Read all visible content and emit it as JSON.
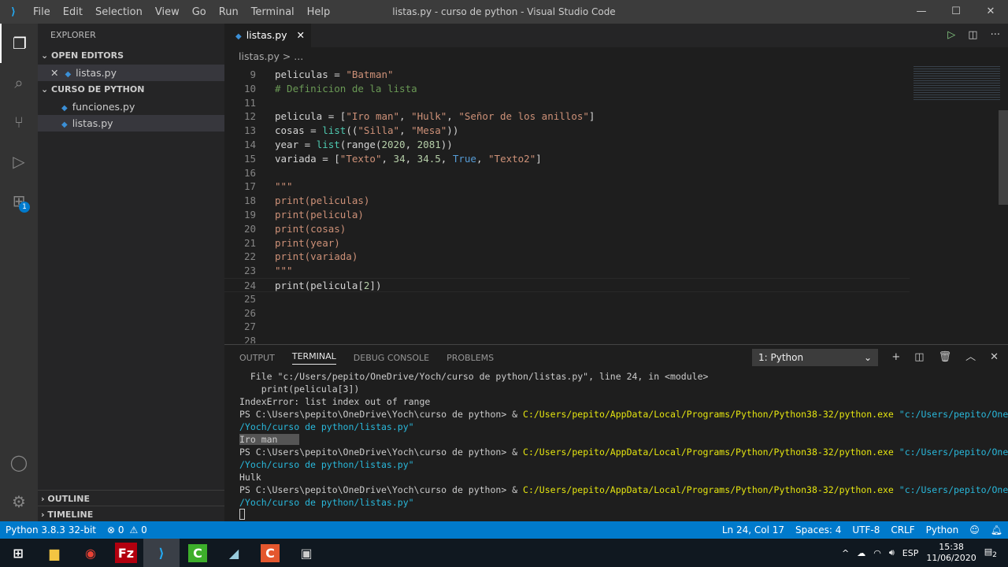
{
  "window": {
    "title": "listas.py - curso de python - Visual Studio Code",
    "menu": [
      "File",
      "Edit",
      "Selection",
      "View",
      "Go",
      "Run",
      "Terminal",
      "Help"
    ]
  },
  "sidebar": {
    "title": "EXPLORER",
    "open_editors": "OPEN EDITORS",
    "open_files": [
      "listas.py"
    ],
    "folder": "CURSO DE PYTHON",
    "files": [
      "funciones.py",
      "listas.py"
    ],
    "outline": "OUTLINE",
    "timeline": "TIMELINE",
    "ext_badge": "1"
  },
  "editor": {
    "tab": "listas.py",
    "breadcrumb": "listas.py > ...",
    "lines": [
      {
        "n": "9",
        "html": "peliculas = <s1>\"Batman\"</s1>"
      },
      {
        "n": "10",
        "html": "<c># Definicion de la lista</c>"
      },
      {
        "n": "11",
        "html": ""
      },
      {
        "n": "12",
        "html": "pelicula = [<s1>\"Iro man\"</s1>, <s1>\"Hulk\"</s1>, <s1>\"Señor de los anillos\"</s1>]"
      },
      {
        "n": "13",
        "html": "cosas = <f>list</f>((<s1>\"Silla\"</s1>, <s1>\"Mesa\"</s1>))"
      },
      {
        "n": "14",
        "html": "year = <f>list</f>(range(<m>2020</m>, <m>2081</m>))"
      },
      {
        "n": "15",
        "html": "variada = [<s1>\"Texto\"</s1>, <m>34</m>, <m>34.5</m>, <k>True</k>, <s1>\"Texto2\"</s1>]"
      },
      {
        "n": "16",
        "html": ""
      },
      {
        "n": "17",
        "html": "<s1>\"\"\"</s1>"
      },
      {
        "n": "18",
        "html": "<s1>print(peliculas)</s1>"
      },
      {
        "n": "19",
        "html": "<s1>print(pelicula)</s1>"
      },
      {
        "n": "20",
        "html": "<s1>print(cosas)</s1>"
      },
      {
        "n": "21",
        "html": "<s1>print(year)</s1>"
      },
      {
        "n": "22",
        "html": "<s1>print(variada)</s1>"
      },
      {
        "n": "23",
        "html": "<s1>\"\"\"</s1>"
      },
      {
        "n": "24",
        "html": "print(pelicula[<m>2</m>])"
      },
      {
        "n": "25",
        "html": ""
      },
      {
        "n": "26",
        "html": ""
      },
      {
        "n": "27",
        "html": ""
      },
      {
        "n": "28",
        "html": ""
      }
    ]
  },
  "panel": {
    "tabs": [
      "OUTPUT",
      "TERMINAL",
      "DEBUG CONSOLE",
      "PROBLEMS"
    ],
    "terminal_select": "1: Python",
    "terminal": [
      [
        "",
        "  File \"c:/Users/pepito/OneDrive/Yoch/curso de python/listas.py\", line 24, in <module>"
      ],
      [
        "",
        "    print(pelicula[3])"
      ],
      [
        "",
        "IndexError: list index out of range"
      ],
      [
        "cmd",
        "PS C:\\Users\\pepito\\OneDrive\\Yoch\\curso de python> & ",
        "C:/Users/pepito/AppData/Local/Programs/Python/Python38-32/python.exe",
        " \"c:/Users/pepito/OneDrive"
      ],
      [
        "b",
        "/Yoch/curso de python/listas.py\""
      ],
      [
        "sel",
        "Iro man"
      ],
      [
        "cmd",
        "PS C:\\Users\\pepito\\OneDrive\\Yoch\\curso de python> & ",
        "C:/Users/pepito/AppData/Local/Programs/Python/Python38-32/python.exe",
        " \"c:/Users/pepito/OneDrive"
      ],
      [
        "b",
        "/Yoch/curso de python/listas.py\""
      ],
      [
        "",
        "Hulk"
      ],
      [
        "cmd",
        "PS C:\\Users\\pepito\\OneDrive\\Yoch\\curso de python> & ",
        "C:/Users/pepito/AppData/Local/Programs/Python/Python38-32/python.exe",
        " \"c:/Users/pepito/OneDrive"
      ],
      [
        "b",
        "/Yoch/curso de python/listas.py\""
      ]
    ]
  },
  "status": {
    "python": "Python 3.8.3 32-bit",
    "errors": "⊗ 0",
    "warnings": "⚠ 0",
    "position": "Ln 24, Col 17",
    "spaces": "Spaces: 4",
    "encoding": "UTF-8",
    "eol": "CRLF",
    "language": "Python"
  },
  "taskbar": {
    "language": "ESP",
    "time": "15:38",
    "date": "11/06/2020",
    "notif": "2"
  }
}
